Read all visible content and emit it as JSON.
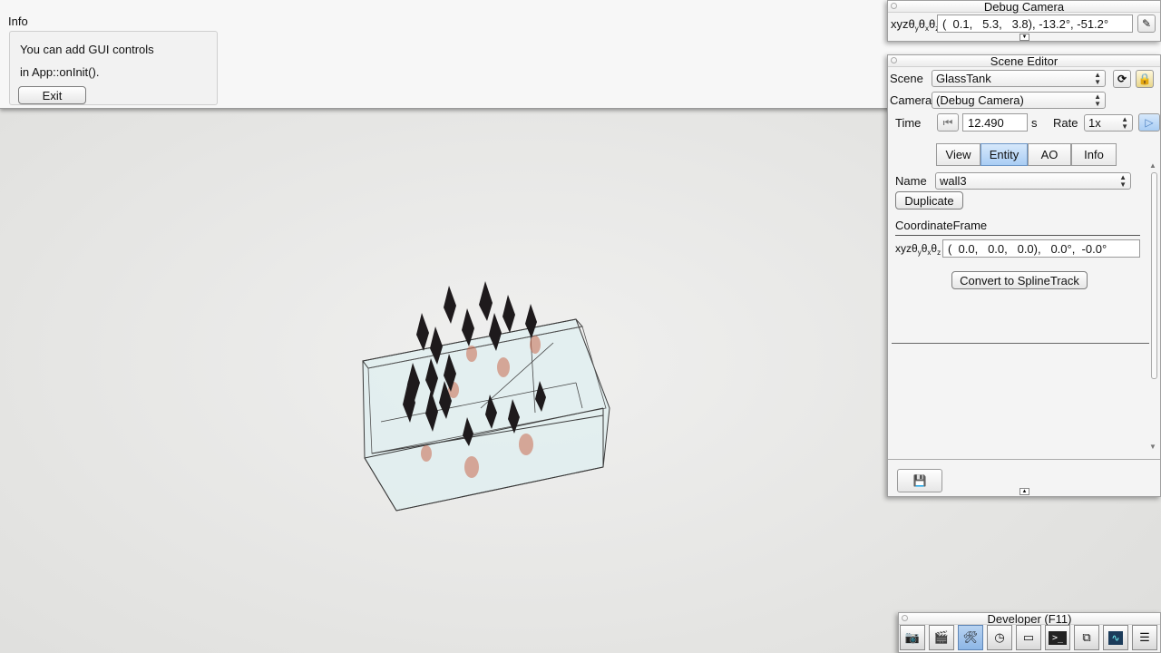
{
  "info": {
    "title": "Info",
    "line1": "You can add GUI controls",
    "line2": "in App::onInit().",
    "exit_label": "Exit"
  },
  "debug_camera": {
    "title": "Debug Camera",
    "xyz_label": "xyz",
    "theta_labels": [
      "θ",
      "y",
      "θ",
      "x",
      "θ",
      "z"
    ],
    "value": "(  0.1,   5.3,   3.8), -13.2°, -51.2°"
  },
  "scene_editor": {
    "title": "Scene Editor",
    "scene_label": "Scene",
    "scene_value": "GlassTank",
    "camera_label": "Camera",
    "camera_value": "(Debug Camera)",
    "time_label": "Time",
    "time_value": "12.490",
    "time_unit": "s",
    "rate_label": "Rate",
    "rate_value": "1x",
    "tabs": [
      "View",
      "Entity",
      "AO",
      "Info"
    ],
    "active_tab": "Entity",
    "name_label": "Name",
    "name_value": "wall3",
    "duplicate_label": "Duplicate",
    "coordinate_frame_label": "CoordinateFrame",
    "frame_xyz_label": "xyz",
    "frame_value": "(  0.0,   0.0,   0.0),   0.0°,  -0.0°",
    "convert_label": "Convert to SplineTrack"
  },
  "developer": {
    "title": "Developer (F11)",
    "icons": [
      "camera-icon",
      "clapperboard-icon",
      "tools-icon",
      "speedometer-icon",
      "window-icon",
      "terminal-icon",
      "scene-icon",
      "profiler-icon",
      "log-icon"
    ]
  },
  "colors": {
    "accent": "#a9cdf4",
    "panel": "#f4f4f4",
    "tank_glass": "#dfeff0"
  }
}
